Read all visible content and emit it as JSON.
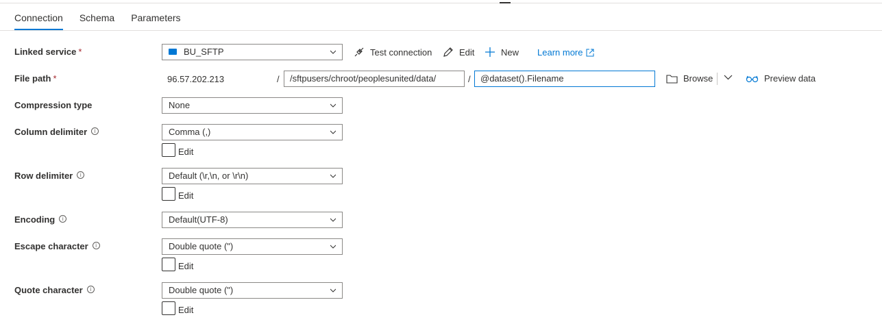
{
  "tabs": [
    {
      "label": "Connection",
      "active": true
    },
    {
      "label": "Schema",
      "active": false
    },
    {
      "label": "Parameters",
      "active": false
    }
  ],
  "linked_service": {
    "label": "Linked service",
    "required_mark": "*",
    "value": "BU_SFTP",
    "icon": "sftp-service-icon",
    "test_connection": "Test connection",
    "edit": "Edit",
    "new": "New",
    "learn_more": "Learn more"
  },
  "file_path": {
    "label": "File path",
    "required_mark": "*",
    "host": "96.57.202.213",
    "separator": "/",
    "directory": "/sftpusers/chroot/peoplesunited/data/",
    "filename": "@dataset().Filename",
    "browse": "Browse",
    "preview": "Preview data"
  },
  "compression": {
    "label": "Compression type",
    "value": "None"
  },
  "column_delimiter": {
    "label": "Column delimiter",
    "value": "Comma (,)",
    "edit_label": "Edit"
  },
  "row_delimiter": {
    "label": "Row delimiter",
    "value": "Default (\\r,\\n, or \\r\\n)",
    "edit_label": "Edit"
  },
  "encoding": {
    "label": "Encoding",
    "value": "Default(UTF-8)"
  },
  "escape_character": {
    "label": "Escape character",
    "value": "Double quote (\")",
    "edit_label": "Edit"
  },
  "quote_character": {
    "label": "Quote character",
    "value": "Double quote (\")",
    "edit_label": "Edit"
  },
  "info_glyph": "i",
  "colors": {
    "accent": "#0078d4",
    "required": "#a4262c",
    "border": "#8a8886"
  }
}
